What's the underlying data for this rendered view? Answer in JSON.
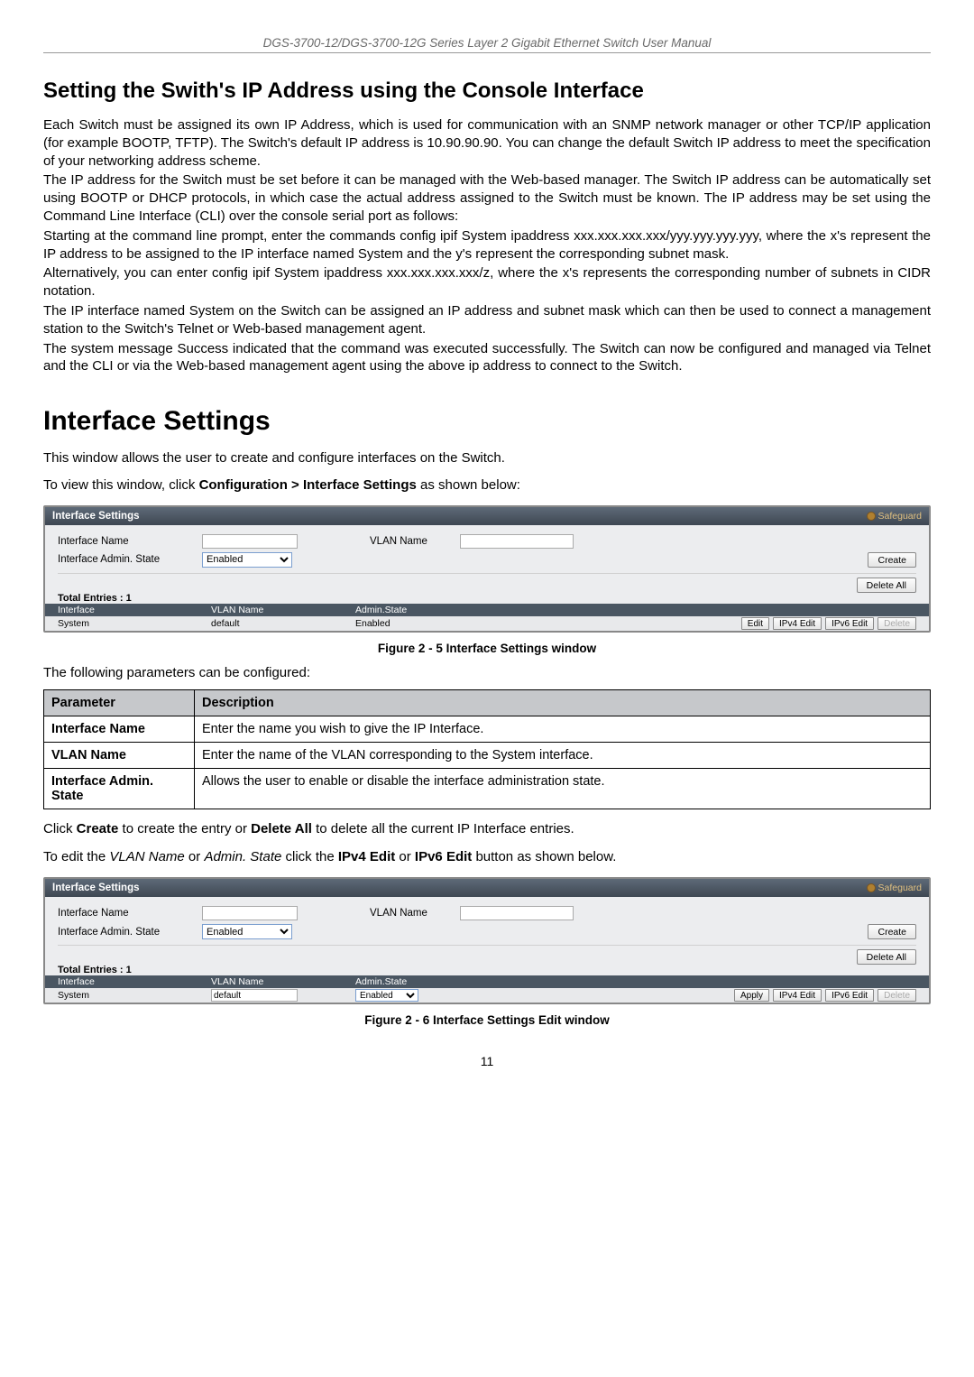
{
  "header": {
    "manual_title": "DGS-3700-12/DGS-3700-12G Series Layer 2 Gigabit Ethernet Switch User Manual"
  },
  "section1": {
    "heading": "Setting the Swith's IP Address using the Console Interface",
    "p1": "Each Switch must be assigned its own IP Address, which is used for communication with an SNMP network manager or other TCP/IP application (for example BOOTP, TFTP). The Switch's default IP address is 10.90.90.90. You can change the default Switch IP address to meet the specification of your networking address scheme.",
    "p2": "The IP address for the Switch must be set before it can be managed with the Web-based manager. The Switch IP address can be automatically set using BOOTP or DHCP protocols, in which case the actual address assigned to the Switch must be known. The IP address may be set using the Command Line Interface (CLI) over the console serial port as follows:",
    "p3": "Starting at the command line prompt, enter the commands config ipif System ipaddress xxx.xxx.xxx.xxx/yyy.yyy.yyy.yyy, where the x's represent the IP address to be assigned to the IP interface named System and the y's represent the corresponding subnet mask.",
    "p4": "Alternatively, you can enter config ipif System ipaddress xxx.xxx.xxx.xxx/z, where the x's represents the corresponding number of subnets in CIDR notation.",
    "p5": "The IP interface named System on the Switch can be assigned an IP address and subnet mask which can then be used to connect a management station to the Switch's Telnet or Web-based management agent.",
    "p6": "The system message Success indicated that the command was executed successfully. The Switch can now be configured and managed via Telnet and the CLI or via the Web-based management agent using the above ip address to connect to the Switch."
  },
  "chapter": {
    "heading": "Interface Settings",
    "intro": "This window allows the user to create and configure interfaces on the Switch.",
    "nav_prefix": "To view this window, click ",
    "nav_bold": "Configuration > Interface Settings",
    "nav_suffix": " as shown below:"
  },
  "panel1": {
    "title": "Interface Settings",
    "safeguard": "Safeguard",
    "labels": {
      "if_name": "Interface Name",
      "vlan_name": "VLAN Name",
      "admin_state": "Interface Admin. State"
    },
    "admin_state_value": "Enabled",
    "create_btn": "Create",
    "delete_all_btn": "Delete All",
    "total_entries": "Total Entries : 1",
    "cols": {
      "if": "Interface",
      "vlan": "VLAN Name",
      "state": "Admin.State"
    },
    "row": {
      "if": "System",
      "vlan": "default",
      "state": "Enabled",
      "edit": "Edit",
      "ipv4": "IPv4 Edit",
      "ipv6": "IPv6 Edit",
      "del": "Delete"
    }
  },
  "fig1_caption": "Figure 2 - 5 Interface Settings window",
  "params_intro": "The following parameters can be configured:",
  "params_table": {
    "head_param": "Parameter",
    "head_desc": "Description",
    "rows": [
      {
        "p": "Interface Name",
        "d": "Enter the name you wish to give the IP Interface."
      },
      {
        "p": "VLAN Name",
        "d": "Enter the name of the VLAN corresponding to the System interface."
      },
      {
        "p": "Interface Admin. State",
        "d": "Allows the user to enable or disable the interface administration state."
      }
    ]
  },
  "after_params": {
    "line1_pre": "Click ",
    "line1_b1": "Create",
    "line1_mid": " to create the entry or ",
    "line1_b2": "Delete All",
    "line1_suf": " to delete all the current IP Interface entries.",
    "line2_pre": "To edit the ",
    "line2_i1": "VLAN Name",
    "line2_mid1": " or ",
    "line2_i2": "Admin. State",
    "line2_mid2": " click the ",
    "line2_b1": "IPv4 Edit",
    "line2_mid3": " or ",
    "line2_b2": "IPv6 Edit",
    "line2_suf": " button as shown below."
  },
  "panel2": {
    "title": "Interface Settings",
    "safeguard": "Safeguard",
    "labels": {
      "if_name": "Interface Name",
      "vlan_name": "VLAN Name",
      "admin_state": "Interface Admin. State"
    },
    "admin_state_value": "Enabled",
    "create_btn": "Create",
    "delete_all_btn": "Delete All",
    "total_entries": "Total Entries : 1",
    "cols": {
      "if": "Interface",
      "vlan": "VLAN Name",
      "state": "Admin.State"
    },
    "row": {
      "if": "System",
      "vlan": "default",
      "state": "Enabled",
      "apply": "Apply",
      "ipv4": "IPv4 Edit",
      "ipv6": "IPv6 Edit",
      "del": "Delete"
    }
  },
  "fig2_caption": "Figure 2 - 6 Interface Settings Edit window",
  "page_number": "11"
}
